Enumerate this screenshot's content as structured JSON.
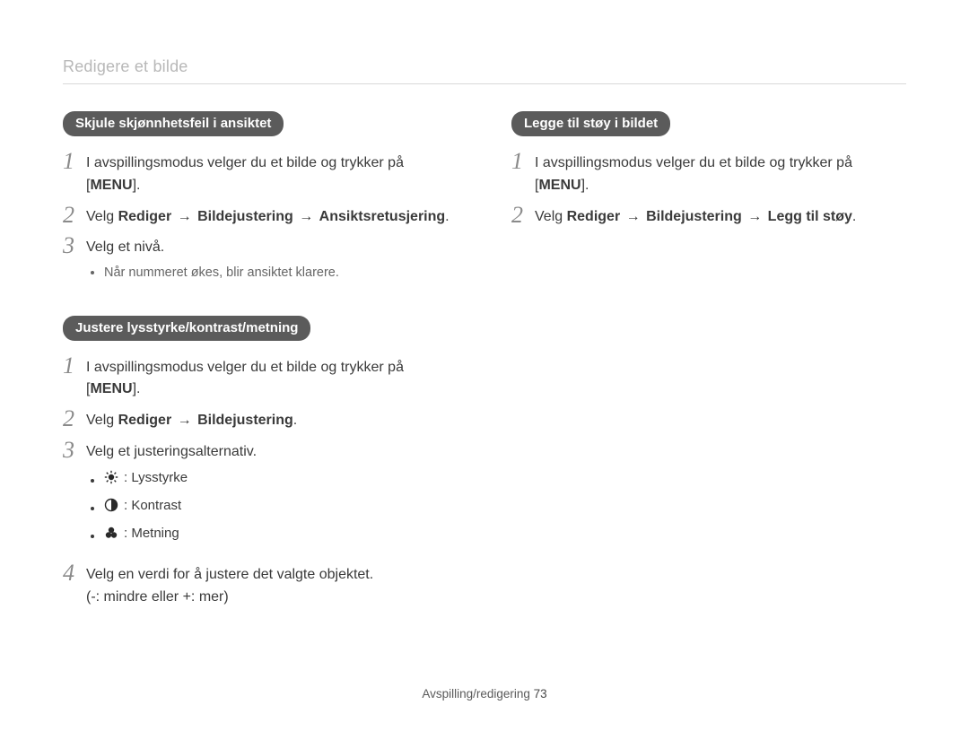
{
  "header": {
    "title": "Redigere et bilde"
  },
  "footer": {
    "section": "Avspilling/redigering",
    "page_number": "73"
  },
  "arrow": "→",
  "left": {
    "sectionA": {
      "heading": "Skjule skjønnhetsfeil i ansiktet",
      "step1_pre": "I avspillingsmodus velger du et bilde og trykker på ",
      "step1_menu_open": "[",
      "step1_menu": "MENU",
      "step1_menu_close": "]",
      "step1_post": ".",
      "step2_pre": "Velg ",
      "step2_p1": "Rediger",
      "step2_p2": "Bildejustering",
      "step2_p3": "Ansiktsretusjering",
      "step2_post": ".",
      "step3": "Velg et nivå.",
      "note": "Når nummeret økes, blir ansiktet klarere."
    },
    "sectionB": {
      "heading": "Justere lysstyrke/kontrast/metning",
      "step1_pre": "I avspillingsmodus velger du et bilde og trykker på ",
      "step1_menu_open": "[",
      "step1_menu": "MENU",
      "step1_menu_close": "]",
      "step1_post": ".",
      "step2_pre": "Velg ",
      "step2_p1": "Rediger",
      "step2_p2": "Bildejustering",
      "step2_post": ".",
      "step3": "Velg et justeringsalternativ.",
      "icon1_label": ": Lysstyrke",
      "icon2_label": ": Kontrast",
      "icon3_label": ": Metning",
      "step4_line1": "Velg en verdi for å justere det valgte objektet.",
      "step4_line2": "(-: mindre eller +: mer)"
    }
  },
  "right": {
    "sectionC": {
      "heading": "Legge til støy i bildet",
      "step1_pre": "I avspillingsmodus velger du et bilde og trykker på ",
      "step1_menu_open": "[",
      "step1_menu": "MENU",
      "step1_menu_close": "]",
      "step1_post": ".",
      "step2_pre": "Velg ",
      "step2_p1": "Rediger",
      "step2_p2": "Bildejustering",
      "step2_p3": "Legg til støy",
      "step2_post": "."
    }
  }
}
